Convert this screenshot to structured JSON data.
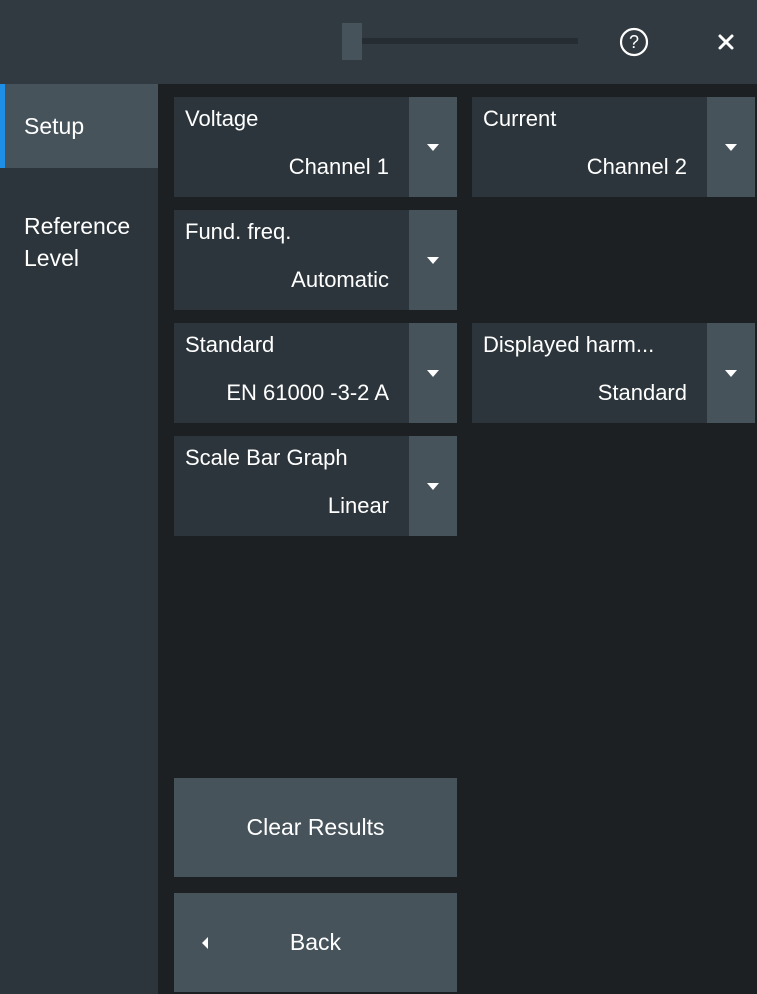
{
  "titlebar": {
    "help_icon": "help-circle-icon",
    "close_icon": "close-icon",
    "close_glyph": "✕"
  },
  "sidebar": {
    "items": [
      {
        "label": "Setup",
        "active": true
      },
      {
        "label": "Reference\nLevel",
        "active": false
      }
    ]
  },
  "controls": {
    "voltage": {
      "label": "Voltage",
      "value": "Channel 1"
    },
    "current": {
      "label": "Current",
      "value": "Channel 2"
    },
    "fund_freq": {
      "label": "Fund. freq.",
      "value": "Automatic"
    },
    "standard": {
      "label": "Standard",
      "value": "EN 61000 -3-2 A"
    },
    "displayed_harm": {
      "label": "Displayed harm...",
      "value": "Standard"
    },
    "scale_bar_graph": {
      "label": "Scale Bar Graph",
      "value": "Linear"
    }
  },
  "buttons": {
    "clear_results": "Clear Results",
    "back": "Back"
  },
  "colors": {
    "accent": "#1f8fe6",
    "panel": "#2c353b",
    "button": "#46535b",
    "background": "#1c2023"
  }
}
